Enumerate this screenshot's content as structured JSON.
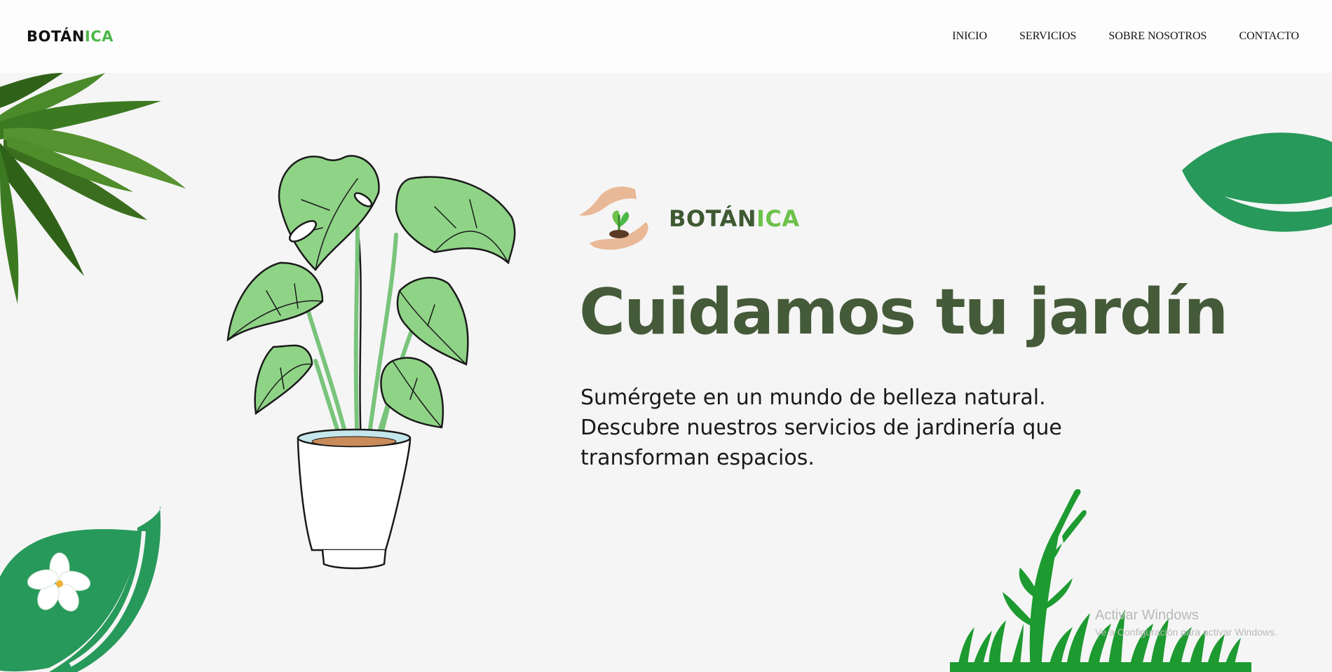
{
  "header": {
    "brand_part1": "BOTÁN",
    "brand_part2": "ICA",
    "nav": [
      "INICIO",
      "SERVICIOS",
      "SOBRE NOSOTROS",
      "CONTACTO"
    ]
  },
  "hero": {
    "logo_part1": "BOTÁN",
    "logo_part2": "ICA",
    "title": "Cuidamos tu jardín",
    "description": "Sumérgete en un mundo de belleza natural. Descubre nuestros servicios de jardinería que transforman espacios."
  },
  "watermark": {
    "line1": "Activar Windows",
    "line2": "Ve a Configuración para activar Windows."
  },
  "icons": [
    "palm-leaves-icon",
    "monstera-plant-icon",
    "hands-sprout-icon",
    "green-leaf-icon",
    "flower-leaf-icon",
    "grass-icon"
  ],
  "colors": {
    "accent_green": "#4cb848",
    "title_green": "#455a38",
    "leaf_green": "#27995a",
    "background": "#f5f5f5"
  }
}
